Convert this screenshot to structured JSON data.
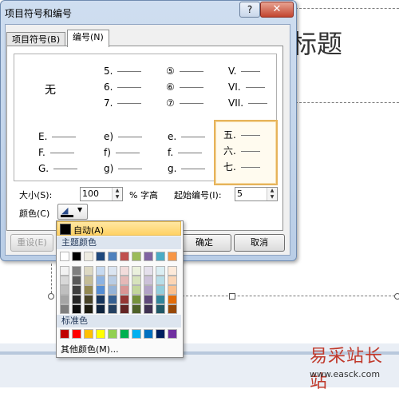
{
  "background": {
    "slide_title_fragment": "标题"
  },
  "dialog": {
    "title": "项目符号和编号",
    "help_label": "?",
    "close_label": "✕",
    "tabs": [
      {
        "label": "项目符号(B)",
        "active": false
      },
      {
        "label": "编号(N)",
        "active": true
      }
    ],
    "gallery": [
      {
        "lines": []
      },
      {
        "lines": [
          "5.",
          "6.",
          "7."
        ]
      },
      {
        "lines": [
          "⑤",
          "⑥",
          "⑦"
        ]
      },
      {
        "lines": [
          "V.",
          "VI.",
          "VII."
        ]
      },
      {
        "lines": [
          "E.",
          "F.",
          "G."
        ]
      },
      {
        "lines": [
          "e)",
          "f)",
          "g)"
        ]
      },
      {
        "lines": [
          "e.",
          "f.",
          "g."
        ]
      },
      {
        "lines": [
          "五.",
          "六.",
          "七."
        ],
        "selected": true
      }
    ],
    "none_label": "无",
    "size_label": "大小(S):",
    "size_value": "100",
    "size_unit": "% 字高",
    "start_label": "起始编号(I):",
    "start_value": "5",
    "color_label": "颜色(C)",
    "reset_label": "重设(E)",
    "ok_label": "确定",
    "cancel_label": "取消"
  },
  "color_menu": {
    "auto_label": "自动(A)",
    "theme_heading": "主题颜色",
    "standard_heading": "标准色",
    "more_label": "其他颜色(M)...",
    "theme_top": [
      "#ffffff",
      "#000000",
      "#eeece1",
      "#1f497d",
      "#4f81bd",
      "#c0504d",
      "#9bbb59",
      "#8064a2",
      "#4bacc6",
      "#f79646"
    ],
    "theme_shades": [
      [
        "#f2f2f2",
        "#7f7f7f",
        "#ddd9c3",
        "#c6d9f0",
        "#dbe5f1",
        "#f2dcdb",
        "#ebf1dd",
        "#e5e0ec",
        "#dbeef3",
        "#fdeada"
      ],
      [
        "#d8d8d8",
        "#595959",
        "#c4bd97",
        "#8db3e2",
        "#b8cce4",
        "#e5b9b7",
        "#d7e3bc",
        "#ccc1d9",
        "#b7dde8",
        "#fbd5b5"
      ],
      [
        "#bfbfbf",
        "#3f3f3f",
        "#938953",
        "#548dd4",
        "#95b3d7",
        "#d99694",
        "#c3d69b",
        "#b2a2c7",
        "#92cddc",
        "#fac08f"
      ],
      [
        "#a5a5a5",
        "#262626",
        "#494429",
        "#17365d",
        "#366092",
        "#953734",
        "#76923c",
        "#5f497a",
        "#31859b",
        "#e36c09"
      ],
      [
        "#7f7f7f",
        "#0c0c0c",
        "#1d1b10",
        "#0f243e",
        "#244061",
        "#632423",
        "#4f6128",
        "#3f3151",
        "#205867",
        "#974806"
      ]
    ],
    "standard": [
      "#c00000",
      "#ff0000",
      "#ffc000",
      "#ffff00",
      "#92d050",
      "#00b050",
      "#00b0f0",
      "#0070c0",
      "#002060",
      "#7030a0"
    ]
  },
  "watermark": {
    "text": "易采站长站",
    "url": "www.easck.com"
  }
}
